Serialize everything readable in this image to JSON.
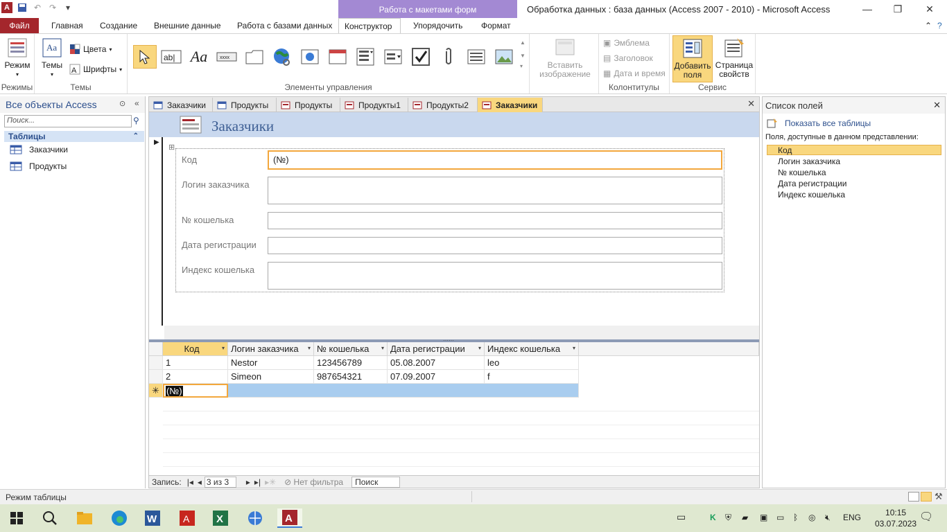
{
  "window": {
    "title": "Обработка данных : база данных (Access 2007 - 2010)  -  Microsoft Access",
    "context_tab_group": "Работа с макетами форм"
  },
  "ribbon_tabs": [
    "Файл",
    "Главная",
    "Создание",
    "Внешние данные",
    "Работа с базами данных",
    "Конструктор",
    "Упорядочить",
    "Формат"
  ],
  "ribbon": {
    "mode_button": "Режим",
    "group_modes": "Режимы",
    "themes_button": "Темы",
    "colors_button": "Цвета",
    "fonts_button": "Шрифты",
    "group_themes": "Темы",
    "group_controls": "Элементы управления",
    "insert_image": "Вставить изображение",
    "logo": "Эмблема",
    "header_title": "Заголовок",
    "date_time": "Дата и время",
    "group_headers": "Колонтитулы",
    "add_fields": "Добавить поля",
    "property_sheet": "Страница свойств",
    "group_tools": "Сервис"
  },
  "nav": {
    "title": "Все объекты Access",
    "search_placeholder": "Поиск...",
    "section": "Таблицы",
    "items": [
      "Заказчики",
      "Продукты"
    ]
  },
  "doc_tabs": [
    "Заказчики",
    "Продукты",
    "Продукты",
    "Продукты1",
    "Продукты2",
    "Заказчики"
  ],
  "form": {
    "title": "Заказчики",
    "fields": [
      {
        "label": "Код",
        "value": "(№)"
      },
      {
        "label": "Логин заказчика",
        "value": ""
      },
      {
        "label": "№ кошелька",
        "value": ""
      },
      {
        "label": "Дата регистрации",
        "value": ""
      },
      {
        "label": "Индекс кошелька",
        "value": ""
      }
    ]
  },
  "datasheet": {
    "columns": [
      "Код",
      "Логин заказчика",
      "№ кошелька",
      "Дата регистрации",
      "Индекс кошелька"
    ],
    "rows": [
      [
        "1",
        "Nestor",
        "123456789",
        "05.08.2007",
        "leo"
      ],
      [
        "2",
        "Simeon",
        "987654321",
        "07.09.2007",
        "f"
      ]
    ],
    "new_row_value": "(№)",
    "new_row_marker": "✳"
  },
  "record_nav": {
    "label": "Запись:",
    "position": "3 из 3",
    "filter": "Нет фильтра",
    "search": "Поиск"
  },
  "field_list": {
    "title": "Список полей",
    "show_all": "Показать все таблицы",
    "caption": "Поля, доступные в данном представлении:",
    "fields": [
      "Код",
      "Логин заказчика",
      "№ кошелька",
      "Дата регистрации",
      "Индекс кошелька"
    ]
  },
  "status": {
    "mode": "Режим таблицы"
  },
  "taskbar": {
    "lang": "ENG",
    "time": "10:15",
    "date": "03.07.2023"
  },
  "colors": {
    "accent": "#a4262c",
    "context": "#a389d3",
    "highlight": "#f9d77e",
    "form_header": "#c9d8ee"
  }
}
